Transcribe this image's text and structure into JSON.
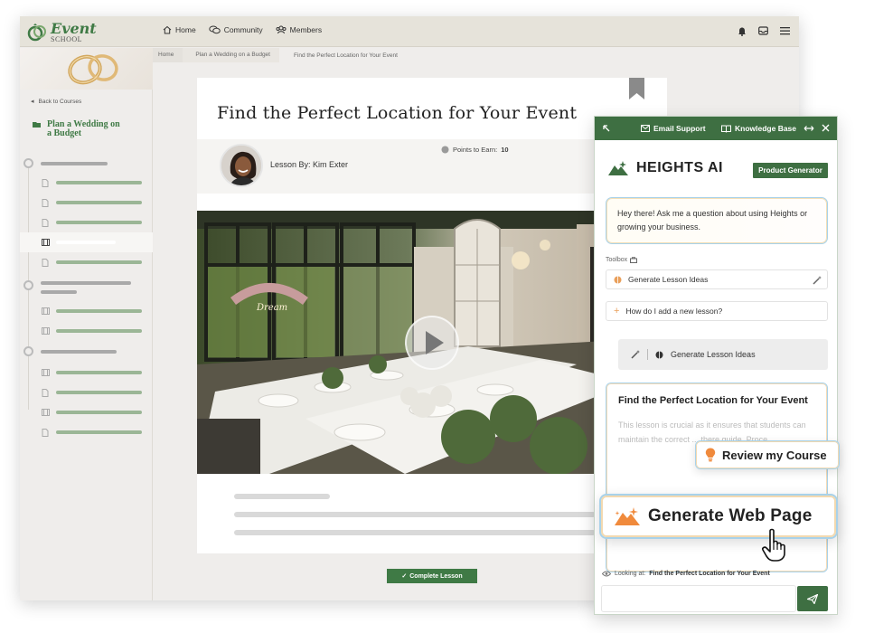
{
  "brand": {
    "line1": "Event",
    "line2": "SCHOOL"
  },
  "nav": {
    "home": "Home",
    "community": "Community",
    "members": "Members"
  },
  "sidebar": {
    "back_label": "Back to Courses",
    "course_line1": "Plan a Wedding on",
    "course_line2": "a Budget"
  },
  "breadcrumb": {
    "home": "Home",
    "course": "Plan a Wedding on a Budget",
    "current": "Find the Perfect Location for Your Event"
  },
  "lesson": {
    "title": "Find the Perfect Location for Your Event",
    "author": "Lesson By: Kim Exter",
    "points_label": "Points to Earn:",
    "points_value": "10",
    "complete_label": "Complete Lesson"
  },
  "ai": {
    "email_support": "Email Support",
    "knowledge_base": "Knowledge Base",
    "brand_name": "HEIGHTS AI",
    "product_badge": "Product Generator",
    "greeting": "Hey there! Ask me a question about using Heights or growing your business.",
    "toolbox_label": "Toolbox",
    "tool_generate": "Generate Lesson Ideas",
    "tool_question": "How do I add a new lesson?",
    "chip_label": "Generate Lesson Ideas",
    "result_title": "Find the Perfect Location for Your Event",
    "result_body": "This lesson is crucial as it ensures that students can maintain the correct ... there guide. Proce...",
    "looking_label": "Looking at:",
    "looking_value": "Find the Perfect Location for Your Event"
  },
  "floating": {
    "review": "Review my Course",
    "generate_web": "Generate Web Page"
  },
  "colors": {
    "brand_green": "#3e6f42",
    "sidebar_green": "#9bb696",
    "accent_blue": "#a8d2ea",
    "accent_orange": "#f08a3c"
  }
}
